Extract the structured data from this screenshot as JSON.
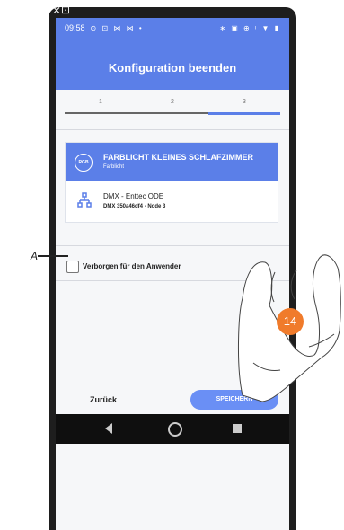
{
  "status_bar": {
    "time": "09:58",
    "left_icons": "⊙ ⊡ ⋈ ⋈ •",
    "right_icons": "∗ ▣ ⊕ ᵎ ▼ ▮"
  },
  "top_icon": "⨯⊡",
  "title": "Konfiguration beenden",
  "stepper": {
    "steps": [
      "1",
      "2",
      "3"
    ],
    "active_step": 3,
    "accent_color": "#5b7fe8"
  },
  "device_card": {
    "icon_text": "RGB",
    "title": "FARBLICHT KLEINES SCHLAFZIMMER",
    "subtitle": "Farblicht",
    "device_name": "DMX - Enttec ODE",
    "device_detail": "DMX 350a46df4 - Node 3"
  },
  "checkbox": {
    "label": "Verborgen für den Anwender",
    "checked": false,
    "annotation": "A"
  },
  "bottom": {
    "back_label": "Zurück",
    "save_label": "SPEICHERN"
  },
  "badge": "14",
  "icons": {
    "back": "back-icon",
    "home": "home-icon",
    "recent": "recent-apps-icon"
  }
}
